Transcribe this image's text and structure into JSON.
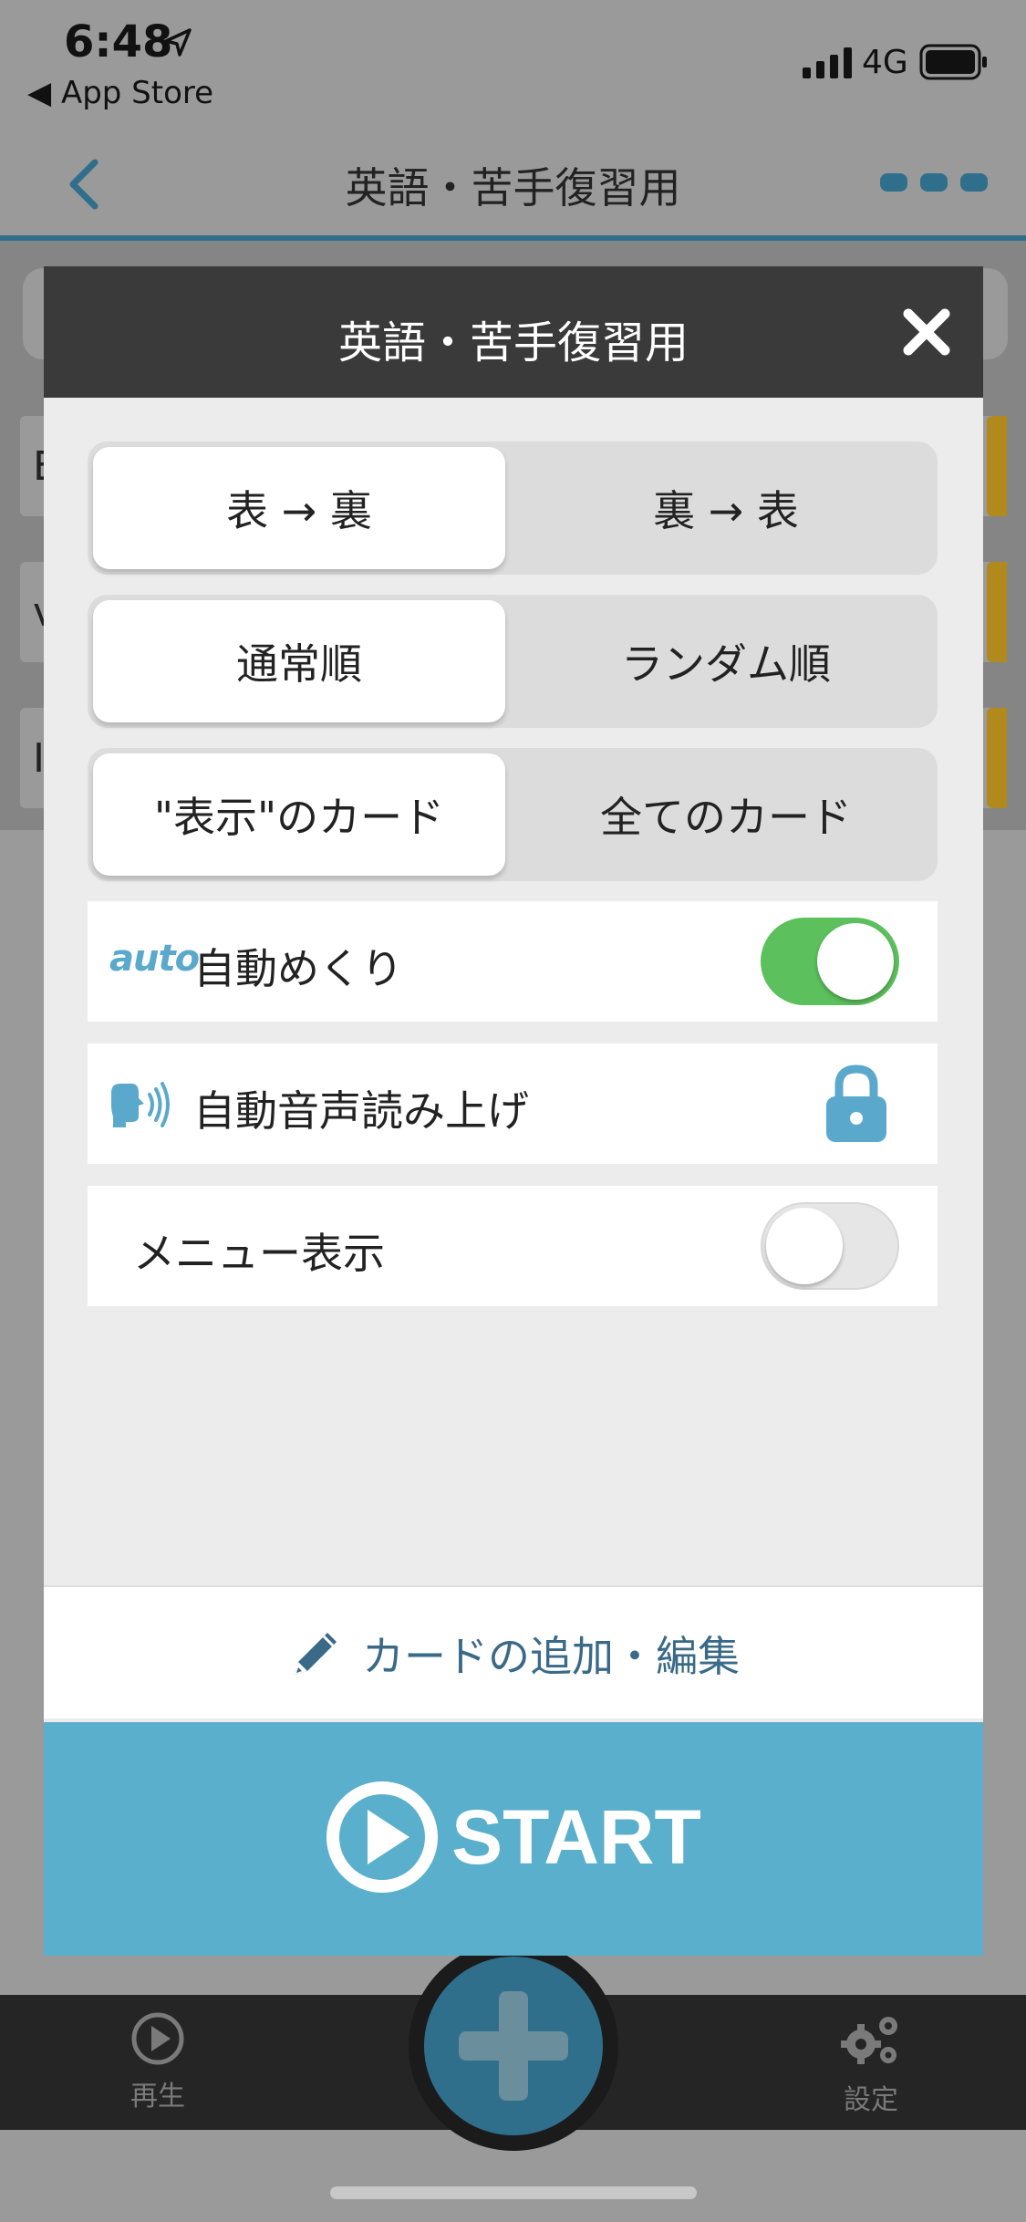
{
  "status_bar": {
    "time": "6:48",
    "back_app": "◀ App Store",
    "network": "4G"
  },
  "nav": {
    "title": "英語・苦手復習用"
  },
  "background_rows": [
    "E",
    "v",
    "I"
  ],
  "modal": {
    "title": "英語・苦手復習用",
    "direction": {
      "options": [
        "表 → 裏",
        "裏 → 表"
      ],
      "selected": 0
    },
    "order": {
      "options": [
        "通常順",
        "ランダム順"
      ],
      "selected": 0
    },
    "cards": {
      "options": [
        "\"表示\"のカード",
        "全てのカード"
      ],
      "selected": 0
    },
    "auto_flip": {
      "icon_text": "auto",
      "label": "自動めくり",
      "enabled": true
    },
    "auto_speech": {
      "label": "自動音声読み上げ",
      "locked": true
    },
    "menu_display": {
      "label": "メニュー表示",
      "enabled": false
    },
    "edit_button": "カードの追加・編集",
    "start_button": "START"
  },
  "tabs": {
    "play": "再生",
    "settings": "設定"
  },
  "colors": {
    "accent": "#5ab0cc",
    "toggle_on": "#5cc05d",
    "header": "#3a3a3a"
  }
}
